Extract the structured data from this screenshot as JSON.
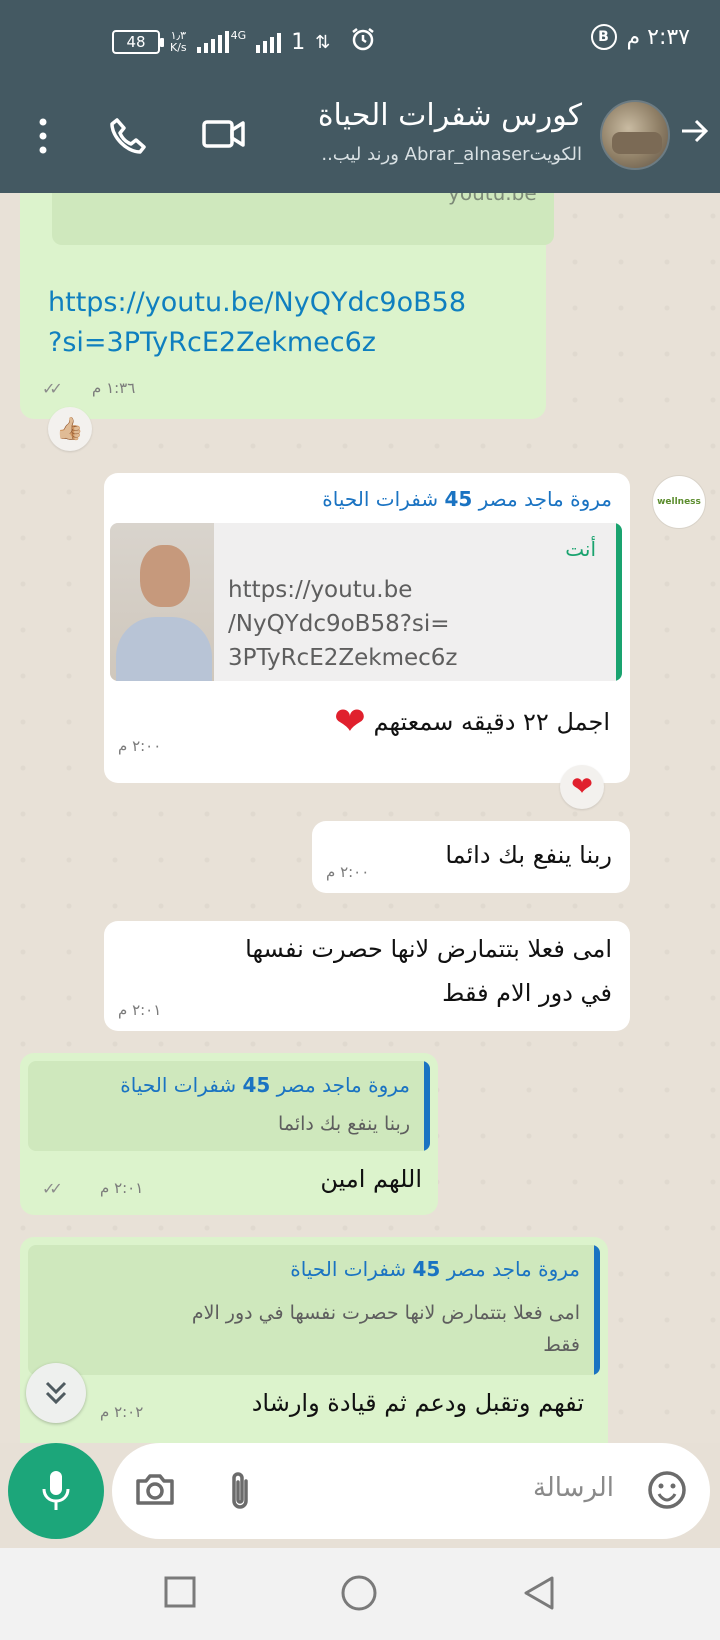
{
  "status_bar": {
    "time": "٢:٣٧ م",
    "battery": "48",
    "speed_value": "١٫٣",
    "speed_unit": "K/s",
    "network": "4G",
    "sim_indicator": "1"
  },
  "header": {
    "title": "كورس شفرات الحياة",
    "subtitle": "الكويتAbrar_alnaser ورند ليب..",
    "icons": [
      "back-arrow-icon",
      "video-call-icon",
      "phone-call-icon",
      "more-options-icon"
    ]
  },
  "messages": {
    "m1": {
      "preview_domain": "youtu.be",
      "link_line1": "https://youtu.be/NyQYdc9oB58",
      "link_line2": "?si=3PTyRcE2Zekmec6z",
      "time": "١:٣٦ م",
      "reaction": "👍🏼"
    },
    "m2": {
      "sender_name": "مروة ماجد مصر",
      "sender_num": "45",
      "sender_tag": "شفرات الحياة",
      "quote_author": "أنت",
      "quote_line1": "https://youtu.be",
      "quote_line2": "/NyQYdc9oB58?si=",
      "quote_line3": "3PTyRcE2Zekmec6z",
      "text": "اجمل ٢٢ دقيقه سمعتهم",
      "emoji": "❤",
      "time": "٢:٠٠ م",
      "reaction": "❤"
    },
    "m3": {
      "text": "ربنا ينفع بك دائما",
      "time": "٢:٠٠ م"
    },
    "m4": {
      "line1": "امى فعلا بتتمارض لانها حصرت نفسها",
      "line2": "في دور الام فقط",
      "time": "٢:٠١ م"
    },
    "m5": {
      "quote_name": "مروة ماجد مصر",
      "quote_num": "45",
      "quote_tag": "شفرات الحياة",
      "quote_text": "ربنا ينفع بك دائما",
      "text": "اللهم امين",
      "time": "٢:٠١ م"
    },
    "m6": {
      "quote_name": "مروة ماجد مصر",
      "quote_num": "45",
      "quote_tag": "شفرات الحياة",
      "quote_line1": "امى فعلا بتتمارض لانها حصرت نفسها في دور الام",
      "quote_line2": "فقط",
      "text": "تفهم وتقبل ودعم ثم قيادة وارشاد",
      "time": "٢:٠٢ م"
    }
  },
  "composer": {
    "placeholder": "الرسالة"
  },
  "colors": {
    "header_bg": "#445962",
    "outgoing_bubble": "#dcf3cc",
    "incoming_bubble": "#ffffff",
    "accent_green": "#1ca67a",
    "link_blue": "#0f7fbf"
  }
}
